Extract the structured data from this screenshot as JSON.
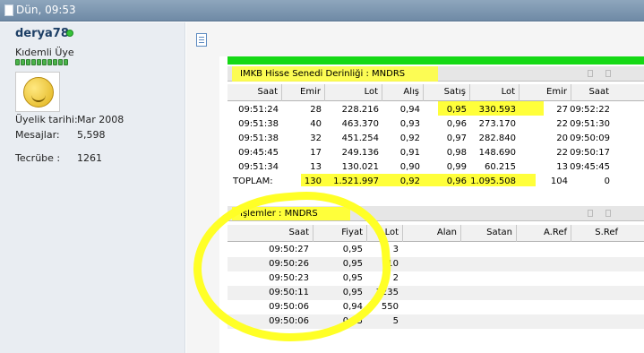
{
  "post_header": {
    "date": "Dün, 09:53"
  },
  "user": {
    "name": "derya78",
    "title": "Kıdemli Üye",
    "reputation_pips": 10,
    "meta": [
      {
        "label": "Üyelik tarihi:",
        "value": "Mar 2008"
      },
      {
        "label": "Mesajlar:",
        "value": "5,598"
      },
      {
        "label": "Tecrübe :",
        "value": "1261"
      }
    ]
  },
  "depth_panel": {
    "title": "IMKB Hisse Senedi Derinliği : MNDRS",
    "columns": [
      "Saat",
      "Emir",
      "Lot",
      "Alış",
      "Satış",
      "Lot",
      "Emir",
      "Saat"
    ],
    "rows": [
      [
        "09:51:24",
        "28",
        "228.216",
        "0,94",
        "0,95",
        "330.593",
        "27",
        "09:52:22"
      ],
      [
        "09:51:38",
        "40",
        "463.370",
        "0,93",
        "0,96",
        "273.170",
        "22",
        "09:51:30"
      ],
      [
        "09:51:38",
        "32",
        "451.254",
        "0,92",
        "0,97",
        "282.840",
        "20",
        "09:50:09"
      ],
      [
        "09:45:45",
        "17",
        "249.136",
        "0,91",
        "0,98",
        "148.690",
        "22",
        "09:50:17"
      ],
      [
        "09:51:34",
        "13",
        "130.021",
        "0,90",
        "0,99",
        "60.215",
        "13",
        "09:45:45"
      ]
    ],
    "total": [
      "TOPLAM:",
      "130",
      "1.521.997",
      "0,92",
      "0,96",
      "1.095.508",
      "104",
      "0"
    ]
  },
  "trades_panel": {
    "title": "İşlemler : MNDRS",
    "columns": [
      "Saat",
      "Fiyat",
      "Lot",
      "Alan",
      "Satan",
      "A.Ref",
      "S.Ref"
    ],
    "rows": [
      [
        "09:50:27",
        "0,95",
        "3"
      ],
      [
        "09:50:26",
        "0,95",
        "10"
      ],
      [
        "09:50:23",
        "0,95",
        "2"
      ],
      [
        "09:50:11",
        "0,95",
        "3235"
      ],
      [
        "09:50:06",
        "0,94",
        "550"
      ],
      [
        "09:50:06",
        "0,95",
        "5"
      ]
    ]
  },
  "colors": {
    "highlight": "#ffff3a",
    "green_bar": "#15d915",
    "header_bar": "#7e98b3"
  },
  "icons": [
    "document-icon",
    "online-status-icon",
    "avatar-smiley",
    "post-icon"
  ]
}
